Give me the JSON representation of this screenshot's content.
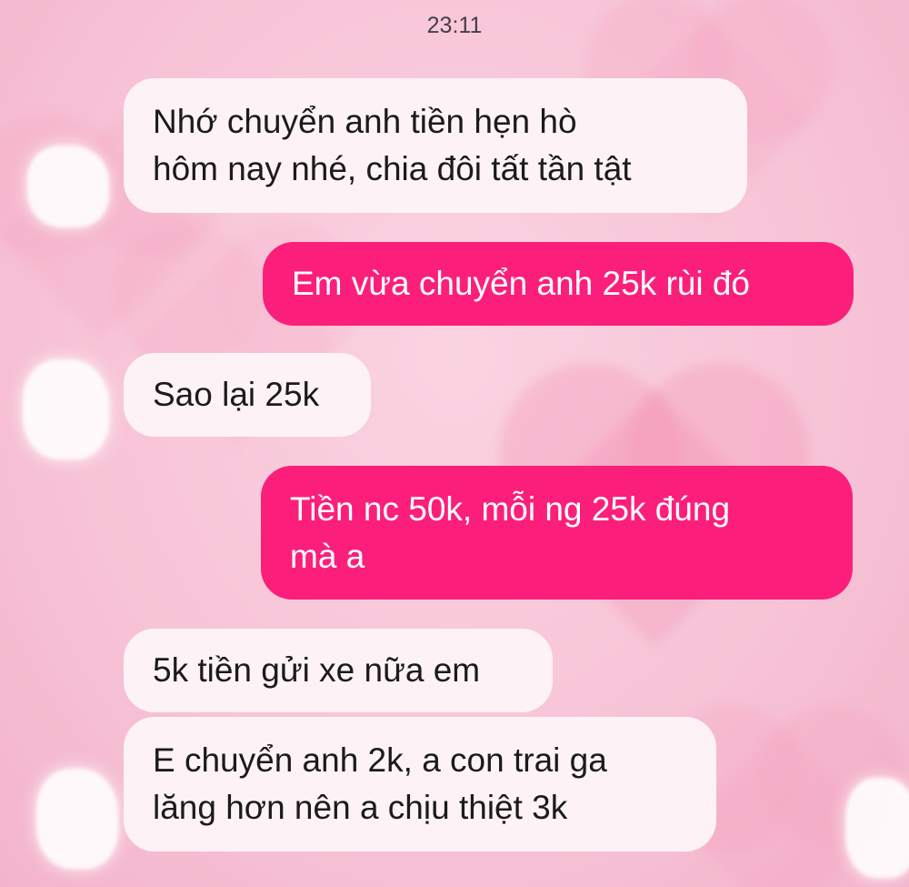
{
  "chat": {
    "timestamp": "23:11",
    "messages": [
      {
        "direction": "incoming",
        "lines": [
          "Nhớ chuyển anh tiền hẹn hò",
          "hôm nay nhé, chia đôi tất tần tật"
        ]
      },
      {
        "direction": "outgoing",
        "lines": [
          "Em vừa chuyển anh 25k rùi đó"
        ]
      },
      {
        "direction": "incoming",
        "lines": [
          "Sao lại 25k"
        ]
      },
      {
        "direction": "outgoing",
        "lines": [
          "Tiền nc 50k, mỗi ng 25k đúng",
          "mà a"
        ]
      },
      {
        "direction": "incoming",
        "lines": [
          "5k tiền gửi xe nữa em"
        ]
      },
      {
        "direction": "incoming",
        "lines": [
          "E chuyển anh 2k, a con trai ga",
          "lăng hơn nên a chịu thiệt 3k"
        ]
      }
    ]
  },
  "colors": {
    "incoming_bubble": "#fdf3f6",
    "outgoing_bubble": "#fb1f7b",
    "background": "#f7c3d6"
  }
}
